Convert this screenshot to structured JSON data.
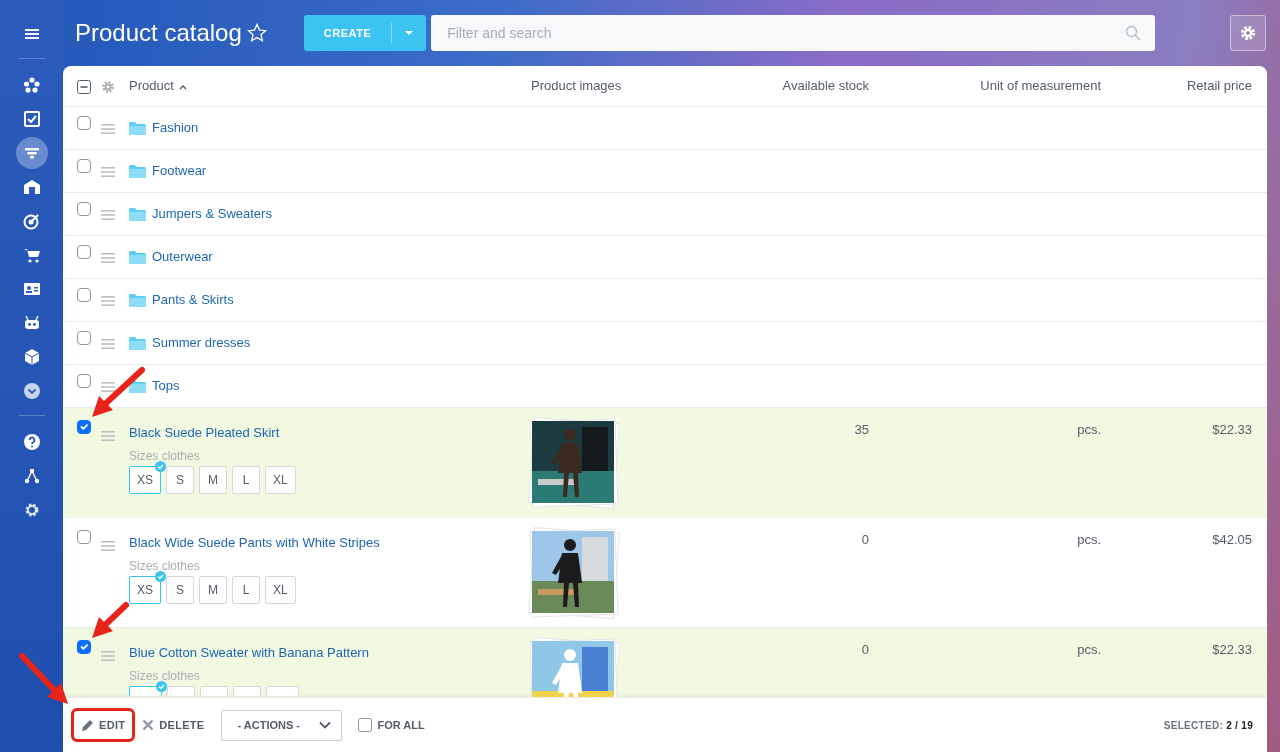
{
  "sidebar": {
    "items": [
      {
        "selected": false
      },
      {
        "selected": false
      },
      {
        "selected": true
      },
      {
        "selected": false
      },
      {
        "selected": false
      },
      {
        "selected": false
      },
      {
        "selected": false
      },
      {
        "selected": false
      },
      {
        "selected": false
      },
      {
        "selected": false
      },
      {
        "selected": false
      },
      {
        "selected": false
      },
      {
        "selected": false
      }
    ]
  },
  "header": {
    "title": "Product catalog",
    "favorite": false,
    "create_button": "CREATE",
    "search": {
      "placeholder": "Filter and search"
    }
  },
  "table": {
    "select_all": {
      "partial": true
    },
    "columns": [
      {
        "label": "Product",
        "sort_ascending": true
      },
      {
        "label": "Product images"
      },
      {
        "label": "Available stock"
      },
      {
        "label": "Unit of measurement"
      },
      {
        "label": "Retail price"
      }
    ],
    "folders": [
      {
        "name": "Fashion",
        "checked": false
      },
      {
        "name": "Footwear",
        "checked": false
      },
      {
        "name": "Jumpers & Sweaters",
        "checked": false
      },
      {
        "name": "Outerwear",
        "checked": false
      },
      {
        "name": "Pants & Skirts",
        "checked": false
      },
      {
        "name": "Summer dresses",
        "checked": false
      },
      {
        "name": "Tops",
        "checked": false
      }
    ],
    "products": [
      {
        "name": "Black Suede Pleated Skirt",
        "checked": true,
        "sizes_label": "Sizes clothes",
        "sizes": [
          {
            "label": "XS",
            "selected": true
          },
          {
            "label": "S",
            "selected": false
          },
          {
            "label": "M",
            "selected": false
          },
          {
            "label": "L",
            "selected": false
          },
          {
            "label": "XL",
            "selected": false
          }
        ],
        "stock": "35",
        "unit": "pcs.",
        "price": "$22.33"
      },
      {
        "name": "Black Wide Suede Pants with White Stripes",
        "checked": false,
        "sizes_label": "Sizes clothes",
        "sizes": [
          {
            "label": "XS",
            "selected": true
          },
          {
            "label": "S",
            "selected": false
          },
          {
            "label": "M",
            "selected": false
          },
          {
            "label": "L",
            "selected": false
          },
          {
            "label": "XL",
            "selected": false
          }
        ],
        "stock": "0",
        "unit": "pcs.",
        "price": "$42.05"
      },
      {
        "name": "Blue Cotton Sweater with Banana Pattern",
        "checked": true,
        "sizes_label": "Sizes clothes",
        "sizes": [
          {
            "selected": true
          },
          {
            "selected": false
          },
          {
            "selected": false
          },
          {
            "selected": false
          },
          {
            "selected": false
          }
        ],
        "stock": "0",
        "unit": "pcs.",
        "price": "$22.33"
      }
    ]
  },
  "footer": {
    "edit": "EDIT",
    "delete": "DELETE",
    "actions": "- ACTIONS -",
    "for_all": {
      "label": "FOR ALL",
      "checked": false
    },
    "selected": "SELECTED: **2 / 19**"
  }
}
